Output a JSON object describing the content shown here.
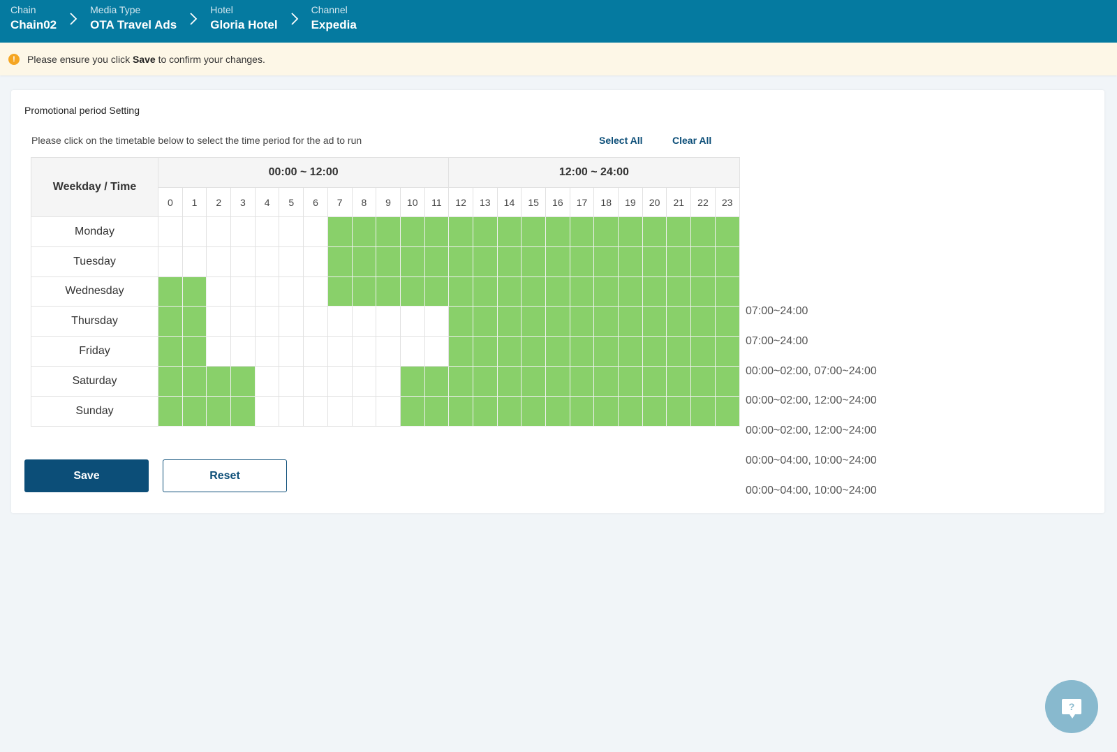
{
  "breadcrumb": [
    {
      "label": "Chain",
      "value": "Chain02"
    },
    {
      "label": "Media Type",
      "value": "OTA Travel Ads"
    },
    {
      "label": "Hotel",
      "value": "Gloria Hotel"
    },
    {
      "label": "Channel",
      "value": "Expedia"
    }
  ],
  "notice": {
    "prefix": "Please ensure you click",
    "bold": "Save",
    "suffix": "to confirm your changes.",
    "icon": "warning-icon"
  },
  "card": {
    "title": "Promotional period Setting",
    "instruction": "Please click on the timetable below to select the time period for the ad to run",
    "select_all": "Select All",
    "clear_all": "Clear All"
  },
  "timetable": {
    "corner_header": "Weekday / Time",
    "half_headers": [
      "00:00 ~ 12:00",
      "12:00 ~ 24:00"
    ],
    "hours": [
      "0",
      "1",
      "2",
      "3",
      "4",
      "5",
      "6",
      "7",
      "8",
      "9",
      "10",
      "11",
      "12",
      "13",
      "14",
      "15",
      "16",
      "17",
      "18",
      "19",
      "20",
      "21",
      "22",
      "23"
    ],
    "selected_color": "#89d06a",
    "rows": [
      {
        "day": "Monday",
        "summary": "07:00~24:00",
        "hours": [
          0,
          0,
          0,
          0,
          0,
          0,
          0,
          1,
          1,
          1,
          1,
          1,
          1,
          1,
          1,
          1,
          1,
          1,
          1,
          1,
          1,
          1,
          1,
          1
        ]
      },
      {
        "day": "Tuesday",
        "summary": "07:00~24:00",
        "hours": [
          0,
          0,
          0,
          0,
          0,
          0,
          0,
          1,
          1,
          1,
          1,
          1,
          1,
          1,
          1,
          1,
          1,
          1,
          1,
          1,
          1,
          1,
          1,
          1
        ]
      },
      {
        "day": "Wednesday",
        "summary": "00:00~02:00, 07:00~24:00",
        "hours": [
          1,
          1,
          0,
          0,
          0,
          0,
          0,
          1,
          1,
          1,
          1,
          1,
          1,
          1,
          1,
          1,
          1,
          1,
          1,
          1,
          1,
          1,
          1,
          1
        ]
      },
      {
        "day": "Thursday",
        "summary": "00:00~02:00, 12:00~24:00",
        "hours": [
          1,
          1,
          0,
          0,
          0,
          0,
          0,
          0,
          0,
          0,
          0,
          0,
          1,
          1,
          1,
          1,
          1,
          1,
          1,
          1,
          1,
          1,
          1,
          1
        ]
      },
      {
        "day": "Friday",
        "summary": "00:00~02:00, 12:00~24:00",
        "hours": [
          1,
          1,
          0,
          0,
          0,
          0,
          0,
          0,
          0,
          0,
          0,
          0,
          1,
          1,
          1,
          1,
          1,
          1,
          1,
          1,
          1,
          1,
          1,
          1
        ]
      },
      {
        "day": "Saturday",
        "summary": "00:00~04:00, 10:00~24:00",
        "hours": [
          1,
          1,
          1,
          1,
          0,
          0,
          0,
          0,
          0,
          0,
          1,
          1,
          1,
          1,
          1,
          1,
          1,
          1,
          1,
          1,
          1,
          1,
          1,
          1
        ]
      },
      {
        "day": "Sunday",
        "summary": "00:00~04:00, 10:00~24:00",
        "hours": [
          1,
          1,
          1,
          1,
          0,
          0,
          0,
          0,
          0,
          0,
          1,
          1,
          1,
          1,
          1,
          1,
          1,
          1,
          1,
          1,
          1,
          1,
          1,
          1
        ]
      }
    ]
  },
  "buttons": {
    "save": "Save",
    "reset": "Reset"
  },
  "help": {
    "glyph": "?",
    "icon": "help-chat-icon"
  }
}
